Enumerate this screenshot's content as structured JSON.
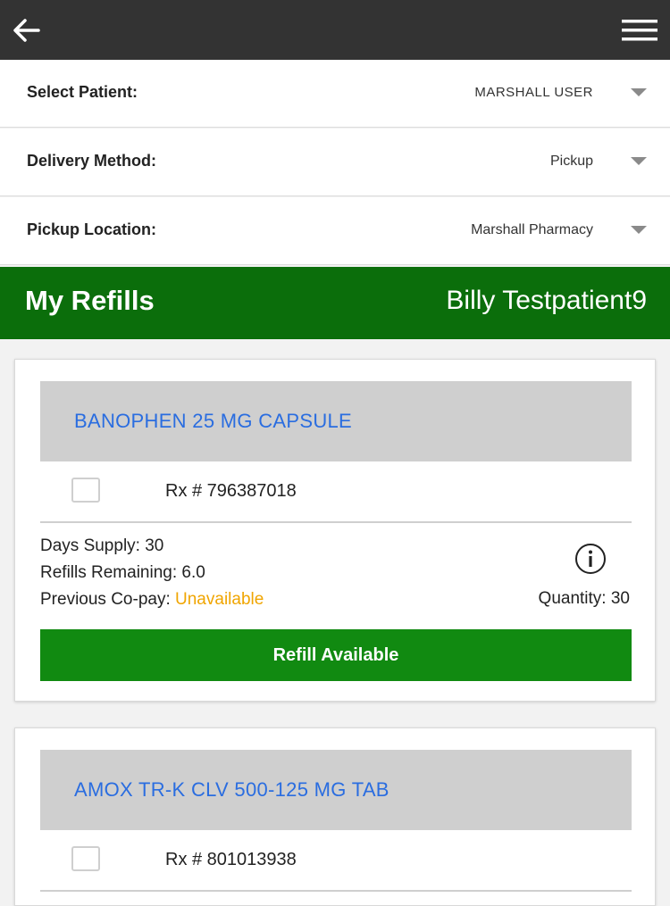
{
  "header": {
    "back_icon": "arrow-left-icon",
    "menu_icon": "hamburger-menu-icon"
  },
  "form": {
    "select_patient": {
      "label": "Select Patient:",
      "value": "MARSHALL USER"
    },
    "delivery_method": {
      "label": "Delivery Method:",
      "value": "Pickup"
    },
    "pickup_location": {
      "label": "Pickup Location:",
      "value": "Marshall Pharmacy"
    }
  },
  "banner": {
    "title": "My Refills",
    "patient_name": "Billy Testpatient9"
  },
  "colors": {
    "topbar": "#333333",
    "banner": "#0b6e0b",
    "refill_button": "#118a11",
    "med_name": "#2a6de0",
    "unavailable": "#f0a500"
  },
  "refills": [
    {
      "med_name": "BANOPHEN 25 MG CAPSULE",
      "rx": "Rx # 796387018",
      "checked": false,
      "days_supply": "Days Supply: 30",
      "refills_remaining": "Refills Remaining: 6.0",
      "copay_label": "Previous Co-pay: ",
      "copay_value": "Unavailable",
      "quantity": "Quantity: 30",
      "button_label": "Refill Available"
    },
    {
      "med_name": "AMOX TR-K CLV 500-125 MG TAB",
      "rx": "Rx # 801013938",
      "checked": false
    }
  ]
}
